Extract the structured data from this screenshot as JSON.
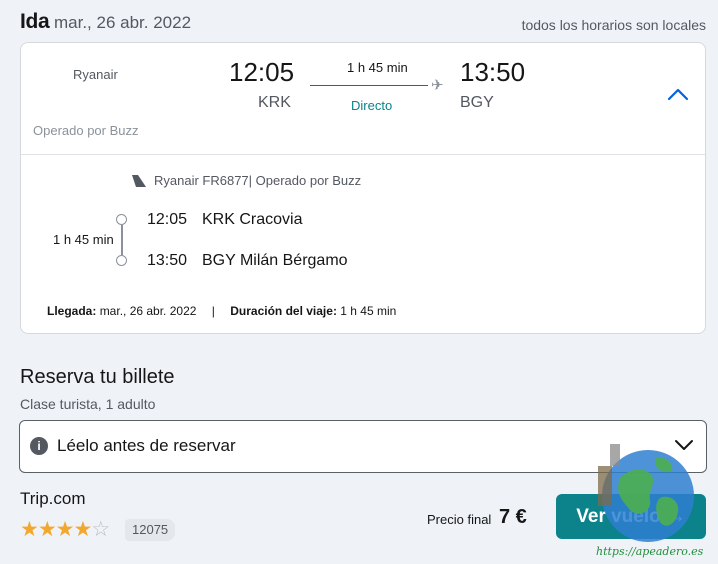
{
  "header": {
    "direction": "Ida",
    "date": "mar., 26 abr. 2022",
    "timezone_note": "todos los horarios son locales"
  },
  "flight": {
    "airline": "Ryanair",
    "operated_by": "Operado por Buzz",
    "departure_time": "12:05",
    "departure_code": "KRK",
    "arrival_time": "13:50",
    "arrival_code": "BGY",
    "duration": "1 h 45 min",
    "stops": "Directo",
    "flight_number_text": "Ryanair FR6877| Operado por Buzz",
    "segment_duration": "1 h 45 min",
    "segments": [
      {
        "time": "12:05",
        "place": "KRK Cracovia"
      },
      {
        "time": "13:50",
        "place": "BGY Milán Bérgamo"
      }
    ],
    "arrival_label": "Llegada:",
    "arrival_value": "mar., 26 abr. 2022",
    "separator": "|",
    "trip_duration_label": "Duración del viaje:",
    "trip_duration_value": "1 h 45 min"
  },
  "booking": {
    "title": "Reserva tu billete",
    "subtitle": "Clase turista, 1 adulto",
    "notice": "Léelo antes de reservar",
    "provider": "Trip.com",
    "rating_stars": 4,
    "rating_max": 5,
    "review_count": "12075",
    "price_label": "Precio final",
    "price": "7 €",
    "view_button": "Ver vuelo",
    "view_button_arrow": "→"
  },
  "watermark": {
    "text": "https://apeadero.es"
  },
  "colors": {
    "accent": "#0c838a",
    "star": "#f2a72e",
    "link_blue": "#0062e3"
  }
}
